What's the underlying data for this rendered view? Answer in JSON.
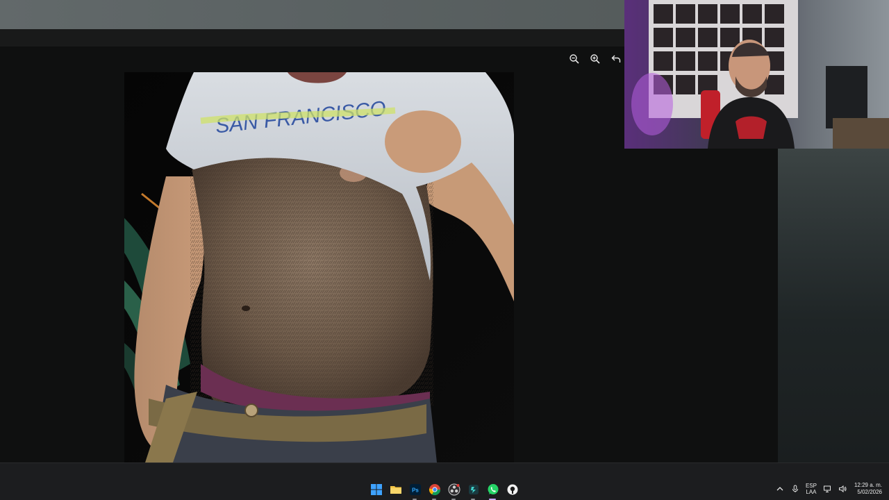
{
  "viewer": {
    "toolbar": [
      {
        "name": "zoom-out",
        "icon": "zoom-out-icon"
      },
      {
        "name": "zoom-in",
        "icon": "zoom-in-icon"
      },
      {
        "name": "back",
        "icon": "back-arrow-icon"
      }
    ],
    "photo_shirt_text": "SAN FRANCISCO"
  },
  "taskbar": {
    "apps": [
      {
        "name": "start",
        "icon": "windows-start-icon"
      },
      {
        "name": "file-explorer",
        "icon": "folder-icon"
      },
      {
        "name": "photoshop",
        "icon": "photoshop-icon",
        "label": "Ps"
      },
      {
        "name": "chrome",
        "icon": "chrome-icon"
      },
      {
        "name": "obs",
        "icon": "obs-icon"
      },
      {
        "name": "app-teal",
        "icon": "app-icon"
      },
      {
        "name": "whatsapp",
        "icon": "whatsapp-icon"
      },
      {
        "name": "app-mic",
        "icon": "recorder-icon"
      }
    ],
    "tray": {
      "language_top": "ESP",
      "language_bottom": "LAA",
      "time": "12:29 a. m.",
      "date": "5/02/2026"
    }
  },
  "colors": {
    "taskbar_bg": "#1c1d1f",
    "viewer_bg": "#0f1010",
    "whatsapp_green": "#25d366",
    "explorer_yellow": "#f3c546",
    "windows_blue": "#3ea2ff",
    "photoshop_blue": "#31a8ff"
  }
}
